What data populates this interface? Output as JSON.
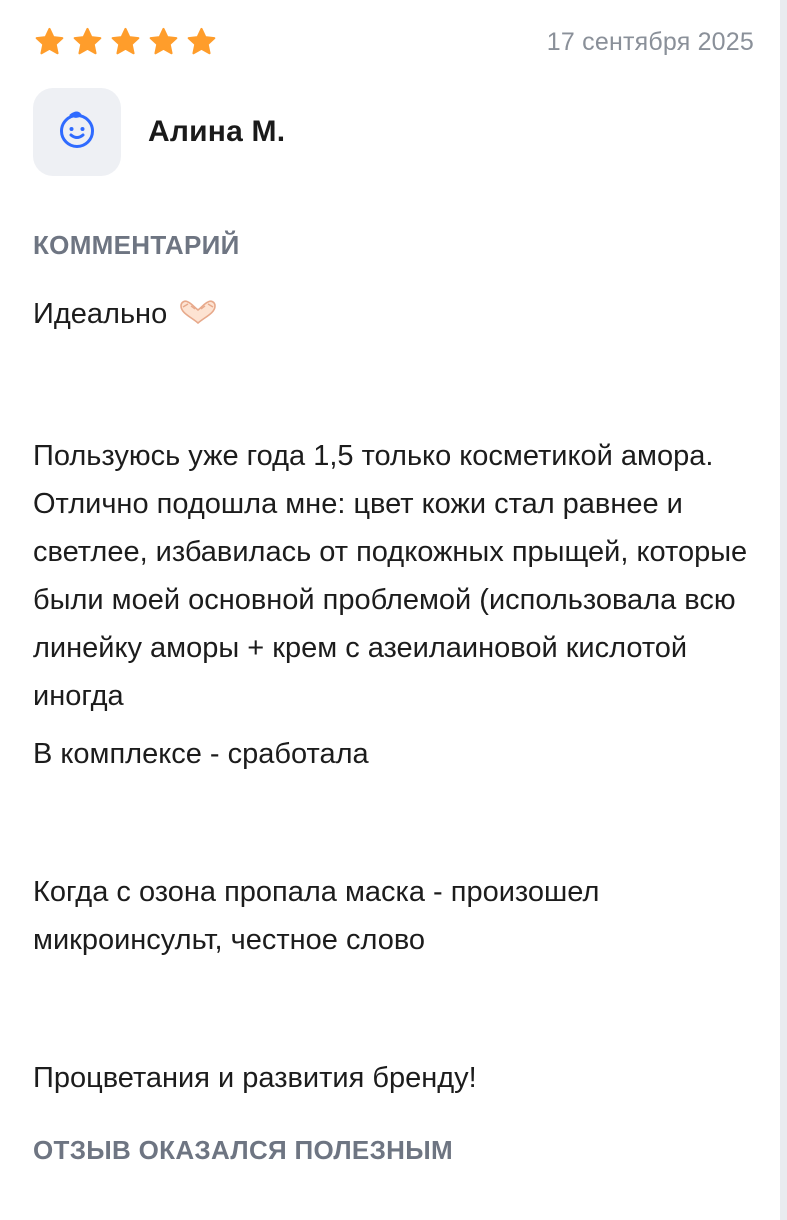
{
  "review": {
    "rating": 5,
    "rating_max": 5,
    "star_color": "#ff9d2b",
    "date": "17 сентября 2025",
    "author": {
      "name": "Алина М.",
      "avatar_icon": "smiley-face-icon",
      "avatar_icon_color": "#2f6bff"
    },
    "comment_label": "КОММЕНТАРИЙ",
    "comment": {
      "p1": "Идеально",
      "p1_emoji": "heart-hands-emoji",
      "p2": "Пользуюсь уже года 1,5 только косметикой амора. Отлично подошла мне: цвет кожи стал равнее и светлее, избавилась от подкожных прыщей, которые были моей основной проблемой (использовала всю линейку аморы + крем с азеилаиновой кислотой иногда",
      "p3": "В комплексе - сработала",
      "p4": "Когда с озона пропала маска - произошел микроинсульт, честное слово",
      "p5": "Процветания и развития бренду!"
    },
    "helpful_label": "ОТЗЫВ ОКАЗАЛСЯ ПОЛЕЗНЫМ"
  }
}
